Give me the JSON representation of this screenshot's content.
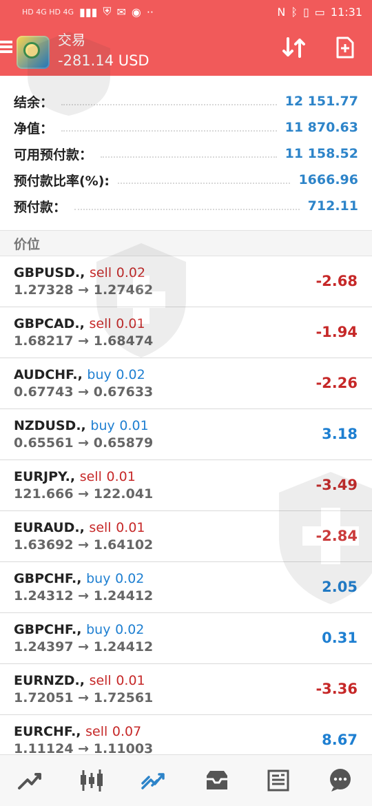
{
  "statusbar": {
    "time": "11:31",
    "left_text": "HD 4G HD 4G",
    "left_icons": [
      "signal-icon",
      "shield-icon",
      "message-icon",
      "notification-icon",
      "more-dots-icon"
    ],
    "right_icons": [
      "nfc-icon",
      "bluetooth-icon",
      "vibration-icon",
      "battery-icon"
    ]
  },
  "header": {
    "title": "交易",
    "balance": "-281.14 USD",
    "icons": [
      "menu-icon",
      "sort-icon",
      "new-order-icon"
    ]
  },
  "summary": [
    {
      "label": "结余：",
      "value": "12 151.77"
    },
    {
      "label": "净值：",
      "value": "11 870.63"
    },
    {
      "label": "可用预付款：",
      "value": "11 158.52"
    },
    {
      "label": "预付款比率(%):",
      "value": "1666.96"
    },
    {
      "label": "预付款：",
      "value": "712.11"
    }
  ],
  "section_title": "价位",
  "positions": [
    {
      "symbol": "GBPUSD.,",
      "side": "sell",
      "lots": "0.02",
      "open": "1.27328",
      "arrow": "→",
      "current": "1.27462",
      "profit": "-2.68"
    },
    {
      "symbol": "GBPCAD.,",
      "side": "sell",
      "lots": "0.01",
      "open": "1.68217",
      "arrow": "→",
      "current": "1.68474",
      "profit": "-1.94"
    },
    {
      "symbol": "AUDCHF.,",
      "side": "buy",
      "lots": "0.02",
      "open": "0.67743",
      "arrow": "→",
      "current": "0.67633",
      "profit": "-2.26"
    },
    {
      "symbol": "NZDUSD.,",
      "side": "buy",
      "lots": "0.01",
      "open": "0.65561",
      "arrow": "→",
      "current": "0.65879",
      "profit": "3.18"
    },
    {
      "symbol": "EURJPY.,",
      "side": "sell",
      "lots": "0.01",
      "open": "121.666",
      "arrow": "→",
      "current": "122.041",
      "profit": "-3.49"
    },
    {
      "symbol": "EURAUD.,",
      "side": "sell",
      "lots": "0.01",
      "open": "1.63692",
      "arrow": "→",
      "current": "1.64102",
      "profit": "-2.84"
    },
    {
      "symbol": "GBPCHF.,",
      "side": "buy",
      "lots": "0.02",
      "open": "1.24312",
      "arrow": "→",
      "current": "1.24412",
      "profit": "2.05"
    },
    {
      "symbol": "GBPCHF.,",
      "side": "buy",
      "lots": "0.02",
      "open": "1.24397",
      "arrow": "→",
      "current": "1.24412",
      "profit": "0.31"
    },
    {
      "symbol": "EURNZD.,",
      "side": "sell",
      "lots": "0.01",
      "open": "1.72051",
      "arrow": "→",
      "current": "1.72561",
      "profit": "-3.36"
    },
    {
      "symbol": "EURCHF.,",
      "side": "sell",
      "lots": "0.07",
      "open": "1.11124",
      "arrow": "→",
      "current": "1.11003",
      "profit": "8.67"
    }
  ],
  "bottom_nav": [
    "quotes-icon",
    "chart-icon",
    "trade-icon",
    "history-icon",
    "news-icon",
    "chat-icon"
  ],
  "colors": {
    "accent": "#f15a5a",
    "value_blue": "#2d84c9",
    "sell_red": "#c62828",
    "buy_blue": "#1e7fd1"
  }
}
